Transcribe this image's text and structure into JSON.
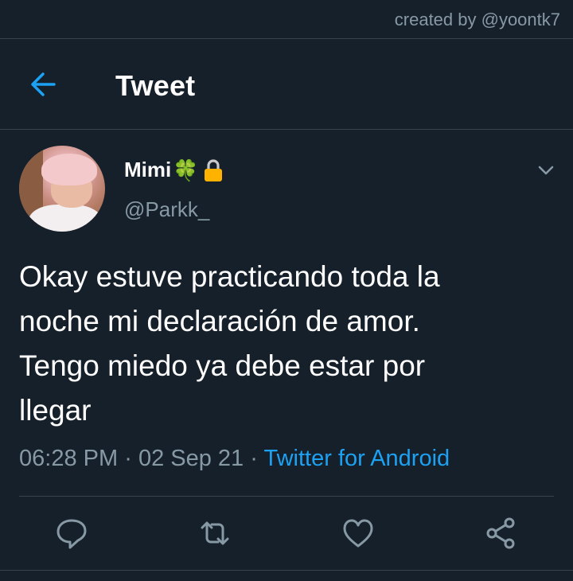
{
  "watermark": "created by @yoontk7",
  "header": {
    "title": "Tweet",
    "back_icon": "arrow-left-icon"
  },
  "tweet": {
    "display_name": "Mimi",
    "badges": [
      "four-leaf-clover-icon",
      "lock-icon"
    ],
    "clover_glyph": "🍀",
    "handle": "@Parkk_",
    "text": "Okay estuve practicando toda la\nnoche mi declaración de amor.\nTengo miedo ya debe estar por\nllegar",
    "time": "06:28 PM",
    "date": "02 Sep 21",
    "dot": "·",
    "source": "Twitter for Android"
  },
  "actions": [
    "reply-icon",
    "retweet-icon",
    "like-icon",
    "share-icon"
  ],
  "colors": {
    "background": "#15202b",
    "separator": "#38444d",
    "secondary_text": "#8899a6",
    "accent": "#1da1f2",
    "lock": "#ffb300"
  }
}
